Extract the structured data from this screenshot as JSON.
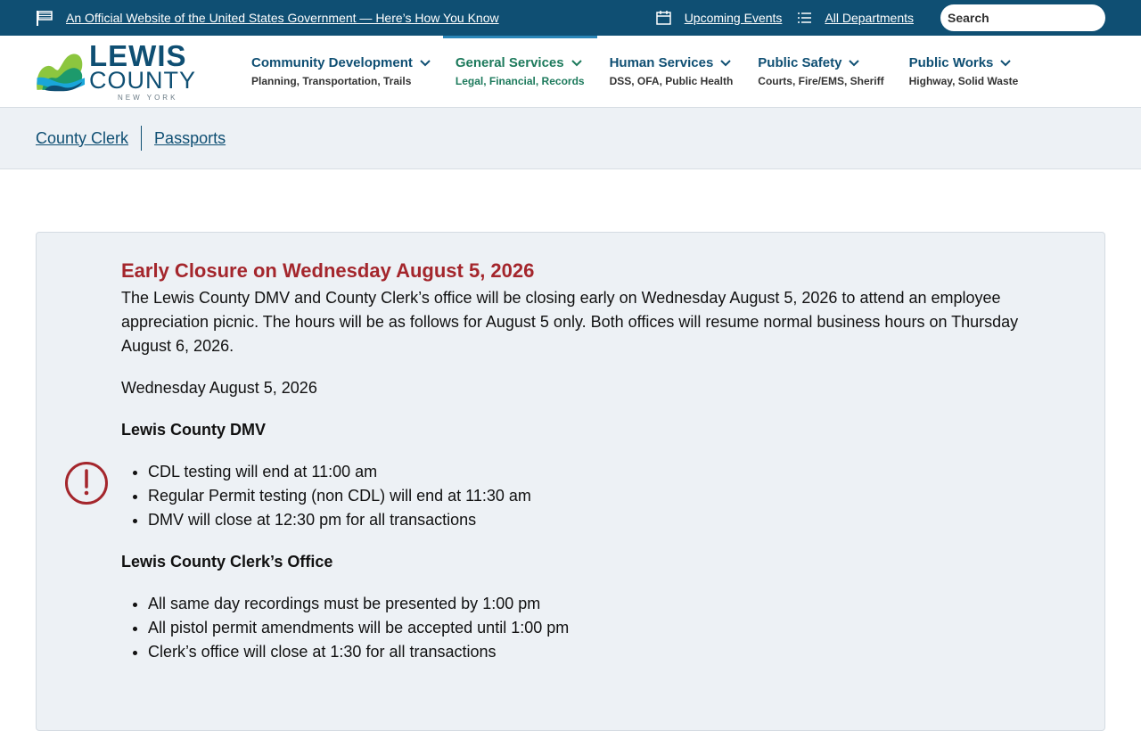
{
  "topbar": {
    "official_text": "An Official Website of the United States Government — Here’s How You Know",
    "events_label": "Upcoming Events",
    "departments_label": "All Departments",
    "search_placeholder": "Search"
  },
  "logo": {
    "line1": "LEWIS",
    "line2": "COUNTY",
    "line3": "NEW YORK"
  },
  "nav": [
    {
      "title": "Community Development",
      "sub": "Planning, Transportation, Trails"
    },
    {
      "title": "General Services",
      "sub": "Legal, Financial, Records"
    },
    {
      "title": "Human Services",
      "sub": "DSS, OFA, Public Health"
    },
    {
      "title": "Public Safety",
      "sub": "Courts, Fire/EMS, Sheriff"
    },
    {
      "title": "Public Works",
      "sub": "Highway, Solid Waste"
    }
  ],
  "breadcrumbs": [
    "County Clerk",
    "Passports"
  ],
  "alert": {
    "title": "Early Closure on Wednesday August 5, 2026",
    "intro": "The Lewis County DMV and County Clerk’s office will be closing early on Wednesday August 5, 2026 to attend an employee appreciation picnic. The hours will be as follows for August 5 only. Both offices will resume normal business hours on Thursday August 6, 2026.",
    "date": "Wednesday August 5, 2026",
    "dmv_heading": "Lewis County DMV",
    "dmv_items": [
      "CDL testing will end at 11:00 am",
      "Regular Permit testing (non CDL) will end at 11:30 am",
      "DMV will close at 12:30 pm for all transactions"
    ],
    "clerk_heading": "Lewis County Clerk’s Office",
    "clerk_items": [
      "All same day recordings must be presented by 1:00 pm",
      "All pistol permit amendments will be accepted until 1:00 pm",
      "Clerk’s office will close at 1:30 for all transactions"
    ]
  },
  "colors": {
    "brand": "#0f4f73",
    "alert_red": "#a4262c",
    "active_green": "#1d7a5c"
  }
}
